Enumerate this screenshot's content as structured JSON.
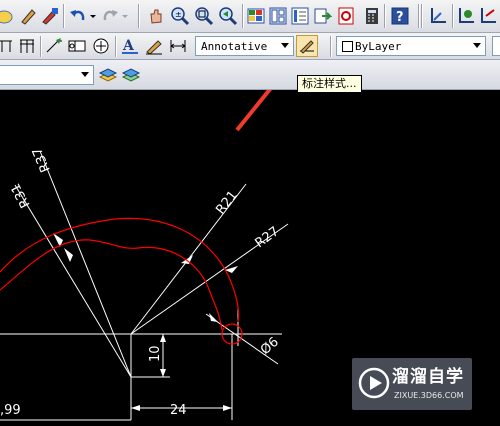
{
  "toolbar_top": {
    "icons": [
      "dim-arc-icon",
      "pencil-icon",
      "match-properties-icon",
      "undo-icon",
      "undo-dropdown-icon",
      "redo-icon",
      "redo-dropdown-icon",
      "pan-icon",
      "zoom-realtime-icon",
      "zoom-window-icon",
      "zoom-previous-icon",
      "properties-icon",
      "design-center-icon",
      "tool-palettes-icon",
      "sheet-set-icon",
      "markup-icon",
      "calculator-icon",
      "help-icon",
      "ucs-icon",
      "ucs-world-icon",
      "ucs-previous-icon",
      "ucs-origin-icon"
    ]
  },
  "toolbar_styles": {
    "text_style_value": "Annotative",
    "layer_value": "ByLayer",
    "dimension_style_tooltip": "标注样式..."
  },
  "drawing": {
    "dimensions": [
      "R37",
      "R31",
      "R21",
      "R27",
      "10",
      "Ø6",
      "24",
      ",99"
    ],
    "colors": {
      "background": "#000000",
      "curve": "#ff0000",
      "line": "#ffffff"
    }
  },
  "watermark": {
    "title": "溜溜自学",
    "url": "ZIXUE.3D66.COM"
  }
}
